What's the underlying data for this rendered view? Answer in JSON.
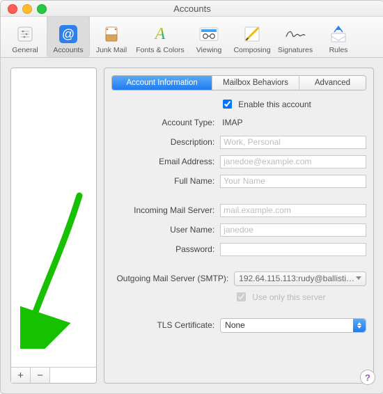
{
  "window": {
    "title": "Accounts"
  },
  "toolbar": [
    {
      "id": "general",
      "label": "General"
    },
    {
      "id": "accounts",
      "label": "Accounts"
    },
    {
      "id": "junk",
      "label": "Junk Mail"
    },
    {
      "id": "fonts",
      "label": "Fonts & Colors"
    },
    {
      "id": "viewing",
      "label": "Viewing"
    },
    {
      "id": "composing",
      "label": "Composing"
    },
    {
      "id": "signatures",
      "label": "Signatures"
    },
    {
      "id": "rules",
      "label": "Rules"
    }
  ],
  "active_toolbar": "accounts",
  "tabs": {
    "info": "Account Information",
    "behaviors": "Mailbox Behaviors",
    "advanced": "Advanced"
  },
  "fields": {
    "enable_label": "Enable this account",
    "enable_checked": true,
    "account_type_label": "Account Type:",
    "account_type_value": "IMAP",
    "description_label": "Description:",
    "description_placeholder": "Work, Personal",
    "email_label": "Email Address:",
    "email_placeholder": "janedoe@example.com",
    "fullname_label": "Full Name:",
    "fullname_placeholder": "Your Name",
    "incoming_label": "Incoming Mail Server:",
    "incoming_placeholder": "mail.example.com",
    "username_label": "User Name:",
    "username_placeholder": "janedoe",
    "password_label": "Password:",
    "smtp_label": "Outgoing Mail Server (SMTP):",
    "smtp_value": "192.64.115.113:rudy@ballisti…",
    "use_only_label": "Use only this server",
    "use_only_checked": true,
    "tls_label": "TLS Certificate:",
    "tls_value": "None"
  },
  "sidebar_buttons": {
    "add": "+",
    "remove": "−"
  },
  "help": "?",
  "colors": {
    "accent": "#2f7ff0",
    "arrow": "#17c000"
  }
}
